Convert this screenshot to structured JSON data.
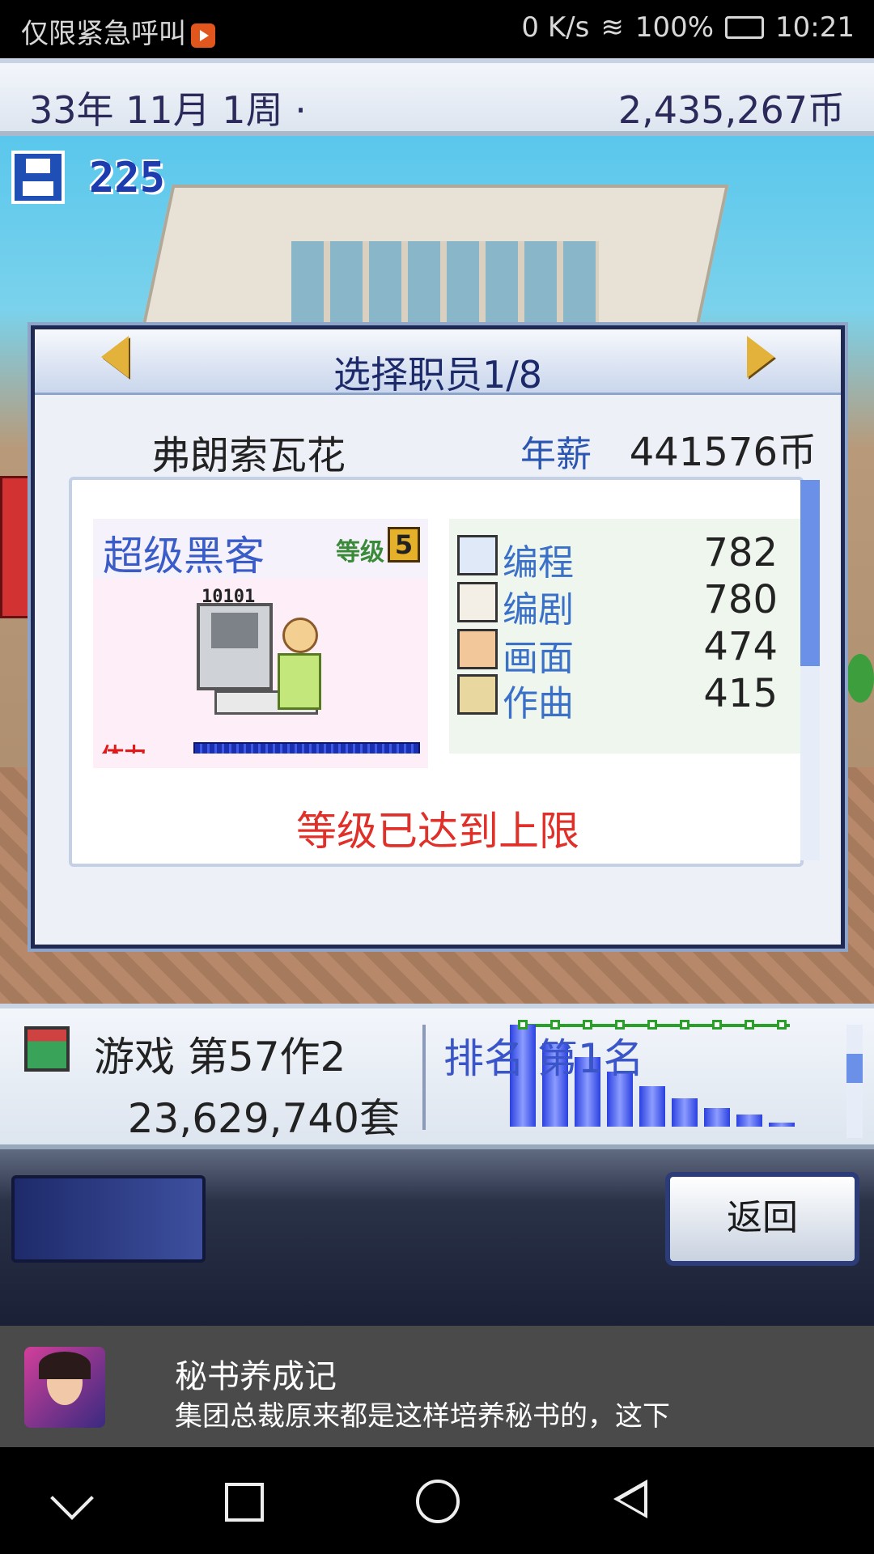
{
  "status_bar": {
    "left_text": "仅限紧急呼叫",
    "speed": "0 K/s",
    "battery": "100%",
    "time": "10:21"
  },
  "top_bar": {
    "date": "33年 11月 1周 ·",
    "money": "2,435,267币"
  },
  "hud": {
    "save_count": "225"
  },
  "dialog": {
    "title": "选择职员1/8",
    "staff_name": "弗朗索瓦花",
    "salary_label": "年薪",
    "salary_value": "441576币",
    "job": "超级黑客",
    "level_label": "等级",
    "level": "5",
    "code_text": "10101",
    "stamina_label": "体力",
    "stamina_level": 1.0,
    "stats": [
      {
        "label": "编程",
        "value": "782",
        "icon": "computer-icon"
      },
      {
        "label": "编剧",
        "value": "780",
        "icon": "book-icon"
      },
      {
        "label": "画面",
        "value": "474",
        "icon": "palette-icon"
      },
      {
        "label": "作曲",
        "value": "415",
        "icon": "trumpet-icon"
      }
    ],
    "message": "等级已达到上限"
  },
  "game_bar": {
    "title": "游戏 第57作2",
    "sales": "23,629,740套",
    "rank": "排名 第1名",
    "rank_bars": [
      100,
      82,
      68,
      54,
      40,
      28,
      18,
      12,
      4
    ]
  },
  "controls": {
    "back_label": "返回"
  },
  "ad": {
    "title": "秘书养成记",
    "description": "集团总裁原来都是这样培养秘书的，这下"
  },
  "colors": {
    "accent_blue": "#3a55c8",
    "message_red": "#e0302a",
    "dialog_border": "#1f2a54"
  }
}
